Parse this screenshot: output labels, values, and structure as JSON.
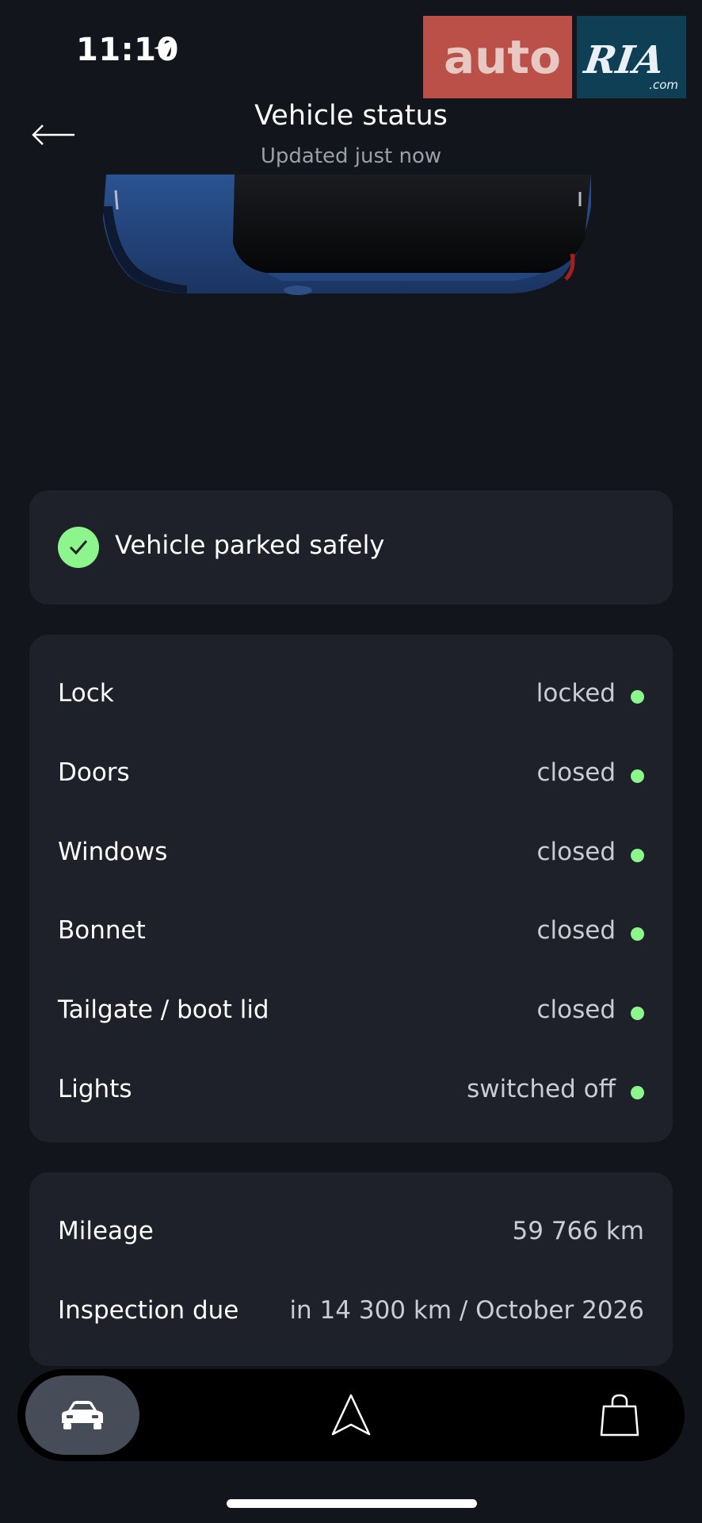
{
  "status_bar": {
    "time": "11:10"
  },
  "watermark": {
    "left_text": "auto",
    "right_text": "RIA",
    "domain": ".com"
  },
  "header": {
    "title": "Vehicle status",
    "subtitle": "Updated just now",
    "back_icon": "arrow-left-icon"
  },
  "parking": {
    "text": "Vehicle parked safely",
    "icon": "check-circle-icon",
    "color": "#8cf58c"
  },
  "status_items": [
    {
      "label": "Lock",
      "value": "locked"
    },
    {
      "label": "Doors",
      "value": "closed"
    },
    {
      "label": "Windows",
      "value": "closed"
    },
    {
      "label": "Bonnet",
      "value": "closed"
    },
    {
      "label": "Tailgate / boot lid",
      "value": "closed"
    },
    {
      "label": "Lights",
      "value": "switched off"
    }
  ],
  "info_items": [
    {
      "label": "Mileage",
      "value": "59 766 km"
    },
    {
      "label": "Inspection due",
      "value": "in 14 300 km / October 2026"
    }
  ],
  "bottom_nav": {
    "items": [
      {
        "icon": "car-icon",
        "active": true
      },
      {
        "icon": "navigation-arrow-icon",
        "active": false
      },
      {
        "icon": "shopping-bag-icon",
        "active": false
      }
    ]
  },
  "colors": {
    "background": "#12151c",
    "card": "#1e212a",
    "ok_indicator": "#8cf58c",
    "active_nav": "#464c58"
  }
}
